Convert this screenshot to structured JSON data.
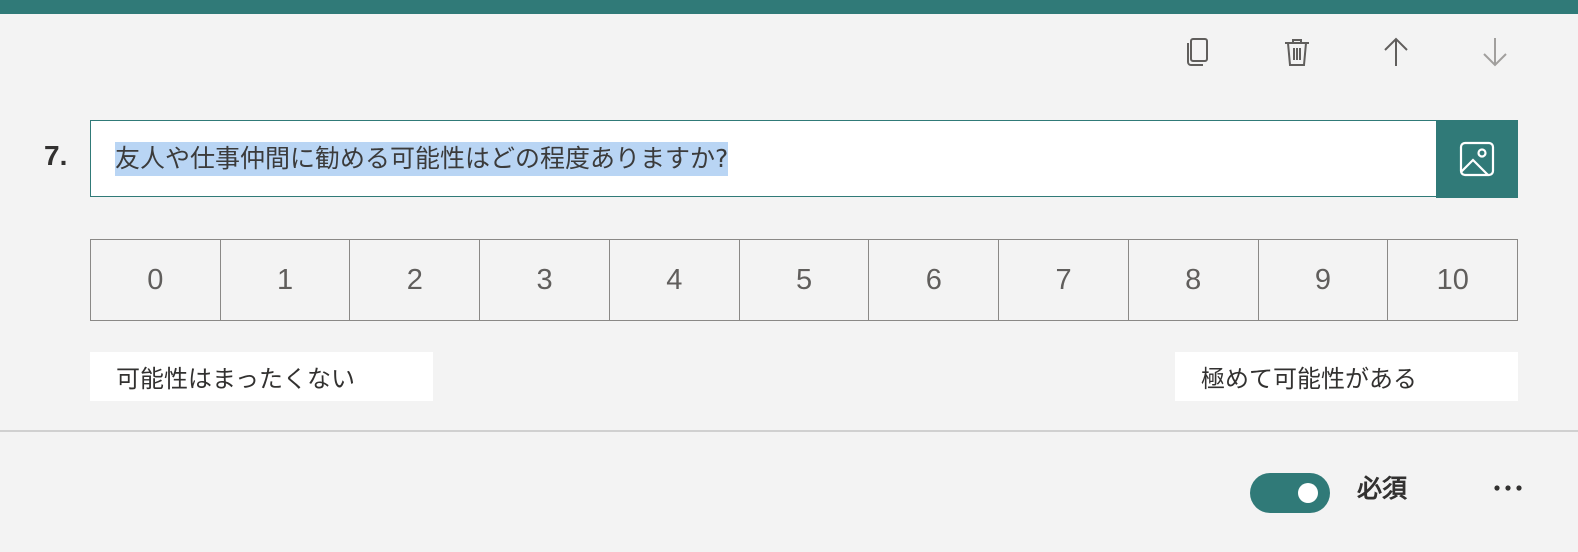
{
  "theme": {
    "accent": "#307a78",
    "background": "#f3f3f3",
    "selection": "#b9d5f4"
  },
  "toolbar": {
    "icons": [
      "copy-icon",
      "trash-icon",
      "arrow-up-icon",
      "arrow-down-icon"
    ]
  },
  "question": {
    "number": "7.",
    "text": "友人や仕事仲間に勧める可能性はどの程度ありますか?",
    "image_icon": "image-icon"
  },
  "scale": {
    "values": [
      "0",
      "1",
      "2",
      "3",
      "4",
      "5",
      "6",
      "7",
      "8",
      "9",
      "10"
    ],
    "left_label": "可能性はまったくない",
    "right_label": "極めて可能性がある"
  },
  "footer": {
    "required_label": "必須",
    "required_on": true,
    "more_icon": "more-icon"
  }
}
